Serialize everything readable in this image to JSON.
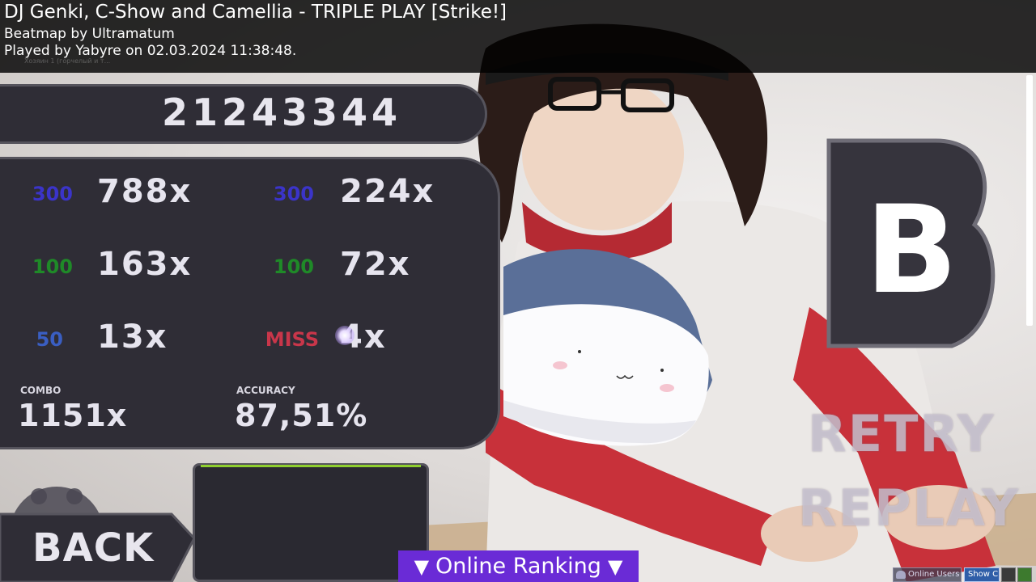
{
  "header": {
    "title": "DJ Genki, C-Show and Camellia - TRIPLE PLAY [Strike!]",
    "mapper_line": "Beatmap by Ultramatum",
    "player_line": "Played by Yabyre on 02.03.2024 11:38:48.",
    "ghost_text": "Хозяин 1 (горчелый и т..."
  },
  "score": "21243344",
  "stats": {
    "left": [
      {
        "judgement": "300",
        "count": "788x"
      },
      {
        "judgement": "100",
        "count": "163x"
      },
      {
        "judgement": "50",
        "count": "13x"
      }
    ],
    "right": [
      {
        "judgement": "300",
        "count": "224x"
      },
      {
        "judgement": "100",
        "count": "72x"
      },
      {
        "judgement": "MISS",
        "count": "4x"
      }
    ],
    "combo_label": "COMBO",
    "combo_value": "1151x",
    "accuracy_label": "ACCURACY",
    "accuracy_value": "87,51%"
  },
  "grade": "B",
  "actions": {
    "retry": "RETRY",
    "replay": "REPLAY",
    "back": "BACK"
  },
  "ranking": {
    "label": "Online Ranking",
    "arrow": "▼"
  },
  "tray": {
    "online_users": "Online Users",
    "show_chat": "Show Chat"
  },
  "colors": {
    "panel": "#2f2d36",
    "panel_border": "#55535c",
    "judgement_300": "#3b34c9",
    "judgement_100": "#1f8a28",
    "judgement_50": "#3a5ec2",
    "judgement_miss": "#c9364a",
    "ranking_bar": "#6a2bd6",
    "graph_line": "#8fcf2e"
  }
}
